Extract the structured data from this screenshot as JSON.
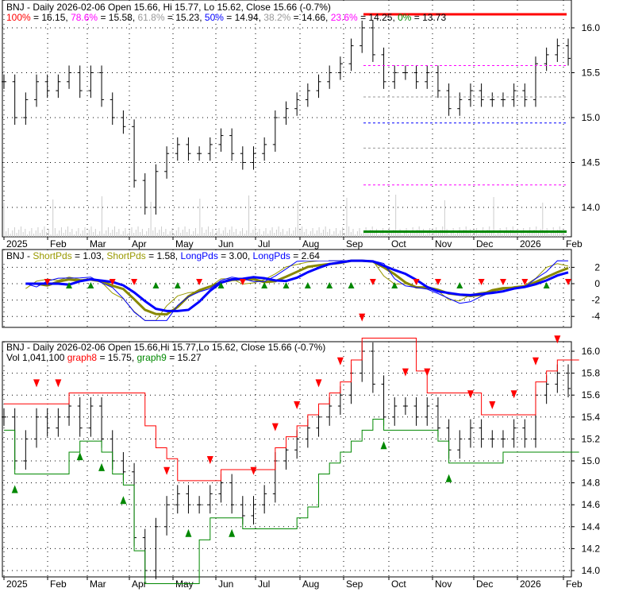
{
  "chart_data": [
    {
      "type": "line",
      "panel": "price",
      "title": "BNJ - Daily 2026-02-06 Open 15.66, Hi 15.77, Lo 15.62, Close 15.66 (-0.7%)",
      "fib": [
        {
          "label": "100%",
          "value": 16.15,
          "color": "#ff0000"
        },
        {
          "label": "78.6%",
          "value": 15.58,
          "color": "#ff00ff"
        },
        {
          "label": "61.8%",
          "value": 15.23,
          "color": "#999999"
        },
        {
          "label": "50%",
          "value": 14.94,
          "color": "#0000ff"
        },
        {
          "label": "38.2%",
          "value": 14.66,
          "color": "#999999"
        },
        {
          "label": "23.6%",
          "value": 14.25,
          "color": "#ff00ff"
        },
        {
          "label": "0%",
          "value": 13.73,
          "color": "#008800"
        }
      ],
      "ylim": [
        13.73,
        16.2
      ],
      "yticks": [
        14.0,
        14.5,
        15.0,
        15.5,
        16.0
      ]
    },
    {
      "type": "line",
      "panel": "oscillator",
      "title_prefix": "BNJ - ",
      "legend": [
        {
          "name": "ShortPds",
          "value": "1.03",
          "color": "#999900"
        },
        {
          "name": "ShortPds",
          "value": "1.58",
          "color": "#999900"
        },
        {
          "name": "LongPds",
          "value": "3.00",
          "color": "#0000ff"
        },
        {
          "name": "LongPds",
          "value": "2.64",
          "color": "#0000ff"
        }
      ],
      "ylim": [
        -5,
        3
      ],
      "yticks": [
        2,
        0,
        -2,
        -4
      ]
    },
    {
      "type": "line",
      "panel": "stops",
      "title": "BNJ - Daily 2026-02-06 Open 15.66,Hi 15.77,Lo 15.62, Close 15.66 (-0.7%)",
      "vol": "Vol 1,041,100",
      "graph8": {
        "name": "graph8",
        "value": "15.75",
        "color": "#ff0000"
      },
      "graph9": {
        "name": "graph9",
        "value": "15.27",
        "color": "#008800"
      },
      "ylim": [
        13.93,
        16.1
      ],
      "yticks": [
        14.0,
        14.2,
        14.4,
        14.6,
        14.8,
        15.0,
        15.2,
        15.4,
        15.6,
        15.8,
        16.0
      ]
    }
  ],
  "x_labels": [
    "2025",
    "Feb",
    "Mar",
    "Apr",
    "May",
    "Jun",
    "Jul",
    "Aug",
    "Sep",
    "Oct",
    "Nov",
    "Dec",
    "2026",
    "Feb"
  ],
  "weekly_close": [
    15.4,
    15.0,
    15.2,
    15.4,
    15.3,
    15.4,
    15.5,
    15.3,
    15.5,
    15.2,
    15.0,
    14.9,
    14.3,
    14.0,
    14.4,
    14.6,
    14.7,
    14.6,
    14.6,
    14.7,
    14.8,
    14.6,
    14.5,
    14.6,
    14.7,
    15.0,
    15.1,
    15.2,
    15.3,
    15.4,
    15.5,
    15.6,
    15.8,
    16.0,
    15.7,
    15.4,
    15.5,
    15.5,
    15.4,
    15.5,
    15.3,
    15.1,
    15.2,
    15.3,
    15.2,
    15.2,
    15.2,
    15.3,
    15.2,
    15.6,
    15.7,
    15.8,
    15.66
  ]
}
